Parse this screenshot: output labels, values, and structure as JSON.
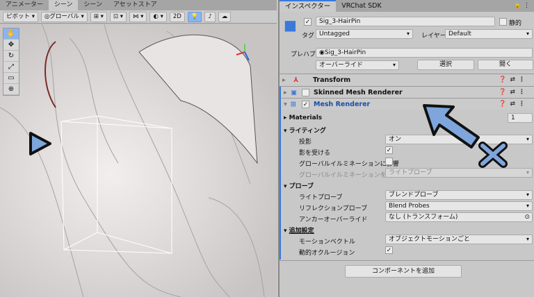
{
  "scene": {
    "tabs": [
      "アニメーター",
      "シーン",
      "シーン",
      "アセットストア"
    ],
    "toolbar": {
      "pivot": "ピボット",
      "global": "グローバル",
      "mode2d": "2D"
    }
  },
  "inspector": {
    "tabs": [
      "インスペクター",
      "VRChat SDK"
    ],
    "object_name": "Sig_3-HairPin",
    "static_label": "静的",
    "tag_label": "タグ",
    "tag_value": "Untagged",
    "layer_label": "レイヤー",
    "layer_value": "Default",
    "prefab_label": "プレハブ",
    "prefab_value": "Sig_3-HairPin",
    "override": "オーバーライド",
    "select": "選択",
    "open": "開く",
    "components": [
      {
        "name": "Transform"
      },
      {
        "name": "Skinned Mesh Renderer",
        "enabled": false
      },
      {
        "name": "Mesh Renderer",
        "enabled": true
      }
    ],
    "materials_label": "Materials",
    "materials_count": "1",
    "lighting": {
      "header": "ライティング",
      "cast_label": "投影",
      "cast_value": "オン",
      "receive_label": "影を受ける",
      "receive": true,
      "gi_contrib_label": "グローバルイルミネーションに影響",
      "gi_contrib": false,
      "gi_receive_label": "グローバルイルミネーションを受け付",
      "gi_receive_value": "ライトプローブ"
    },
    "probes": {
      "header": "プローブ",
      "light_label": "ライトプローブ",
      "light_value": "ブレンドプローブ",
      "reflection_label": "リフレクションプローブ",
      "reflection_value": "Blend Probes",
      "anchor_label": "アンカーオーバーライド",
      "anchor_value": "なし (トランスフォーム)"
    },
    "additional": {
      "header": "追加設定",
      "motion_label": "モーションベクトル",
      "motion_value": "オブジェクトモーションごと",
      "occlusion_label": "動的オクルージョン",
      "occlusion": true
    },
    "add_component": "コンポーネントを追加"
  },
  "colors": {
    "accent": "#3a79d8",
    "annotation": "#7ea6dc"
  }
}
